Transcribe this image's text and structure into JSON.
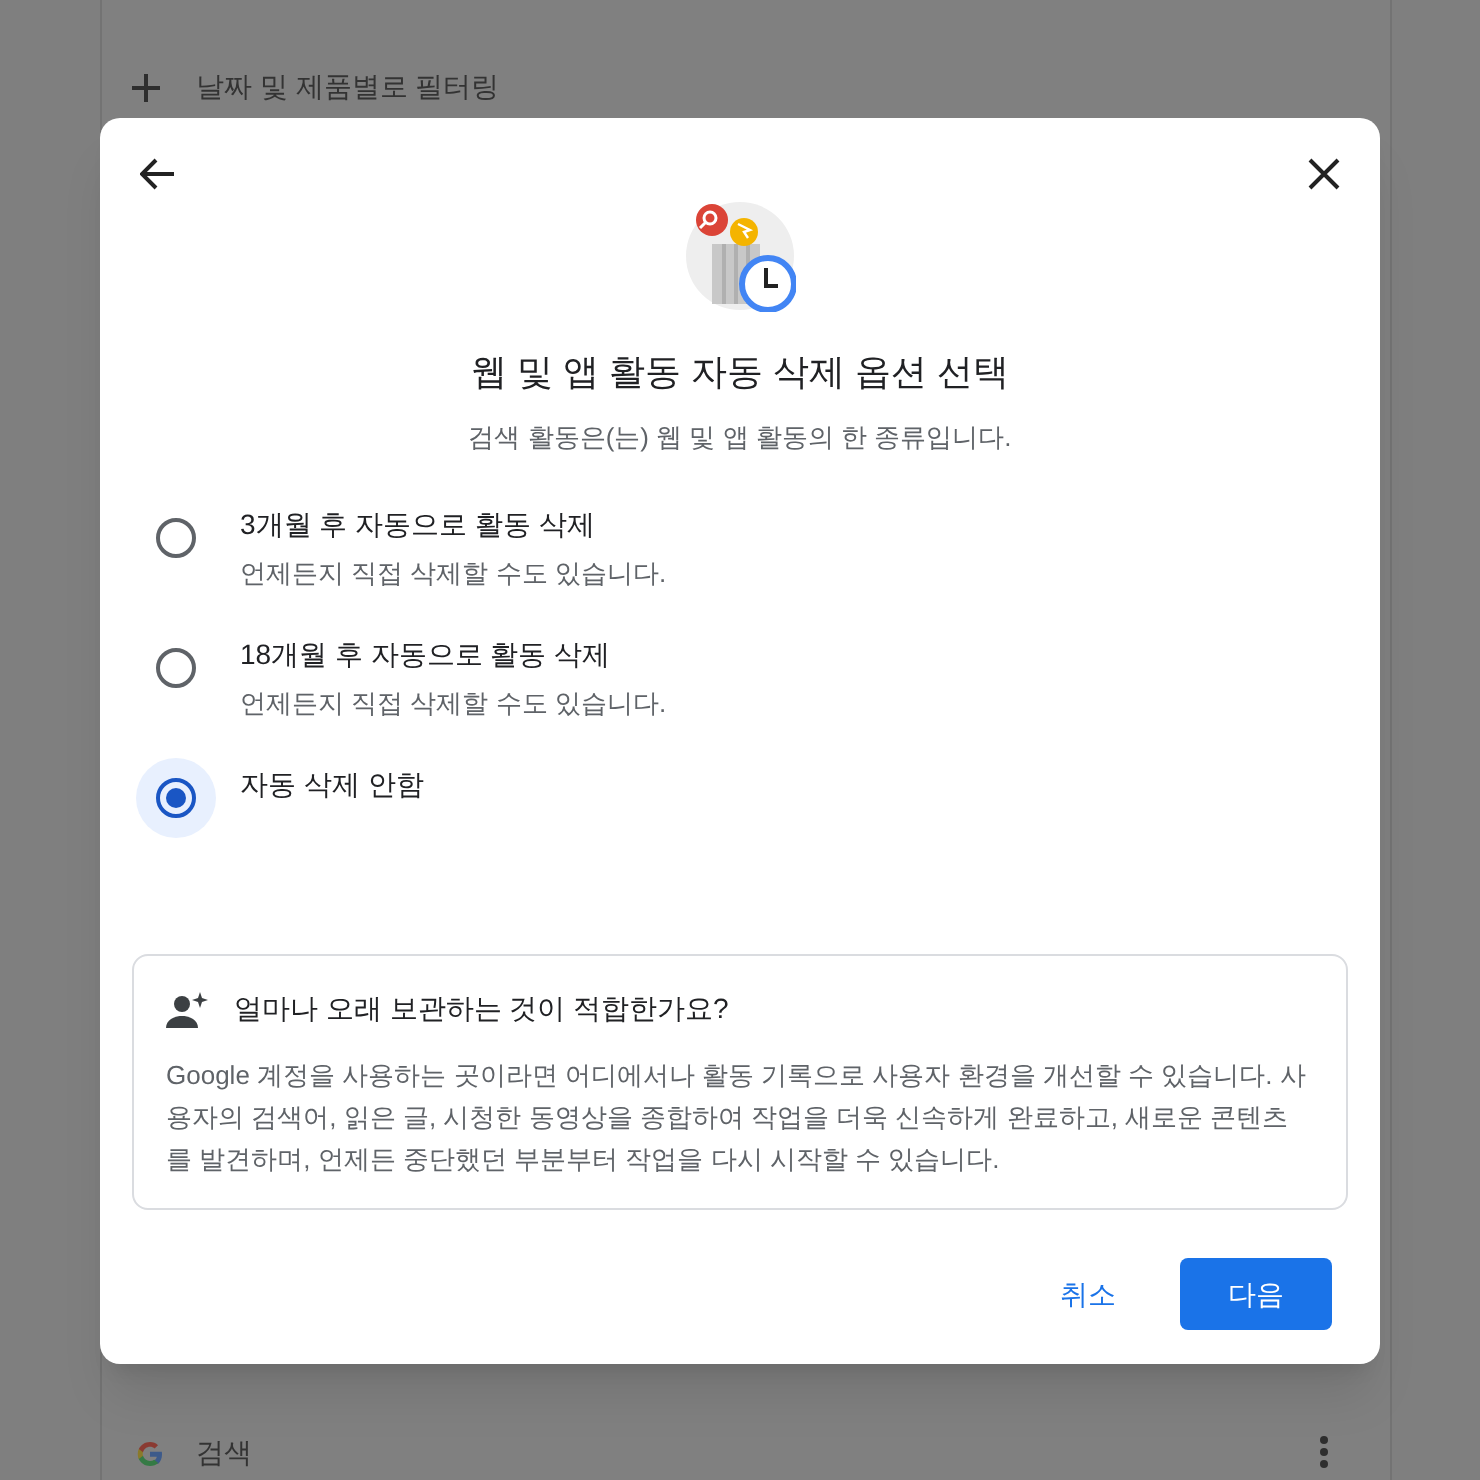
{
  "background": {
    "filter_label": "날짜 및 제품별로 필터링",
    "search_row_label": "검색"
  },
  "dialog": {
    "title": "웹 및 앱 활동 자동 삭제 옵션 선택",
    "subtitle": "검색 활동은(는) 웹 및 앱 활동의 한 종류입니다.",
    "options": [
      {
        "label": "3개월 후 자동으로 활동 삭제",
        "description": "언제든지 직접 삭제할 수도 있습니다.",
        "selected": false
      },
      {
        "label": "18개월 후 자동으로 활동 삭제",
        "description": "언제든지 직접 삭제할 수도 있습니다.",
        "selected": false
      },
      {
        "label": "자동 삭제 안함",
        "selected": true
      }
    ],
    "info": {
      "heading": "얼마나 오래 보관하는 것이 적합한가요?",
      "body": "Google 계정을 사용하는 곳이라면 어디에서나 활동 기록으로 사용자 환경을 개선할 수 있습니다. 사용자의 검색어, 읽은 글, 시청한 동영상을 종합하여 작업을 더욱 신속하게 완료하고, 새로운 콘텐츠를 발견하며, 언제든 중단했던 부분부터 작업을 다시 시작할 수 있습니다."
    },
    "buttons": [
      {
        "label": "취소",
        "kind": "text"
      },
      {
        "label": "다음",
        "kind": "filled"
      }
    ]
  }
}
